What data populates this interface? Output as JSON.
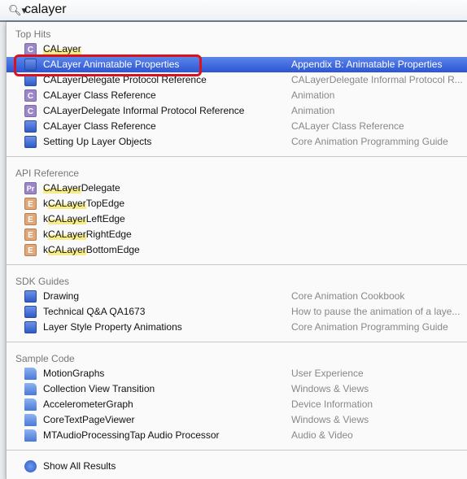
{
  "search": {
    "query": "calayer",
    "icon": "search-icon"
  },
  "sections": [
    {
      "title": "Top Hits",
      "items": [
        {
          "icon": "class",
          "glyph": "C",
          "pre": "",
          "hl": "CALayer",
          "post": "",
          "sub": ""
        },
        {
          "icon": "doc",
          "glyph": "",
          "pre": "CALayer Animatable Properties",
          "hl": "",
          "post": "",
          "sub": "Appendix B: Animatable Properties",
          "selected": true
        },
        {
          "icon": "doc",
          "glyph": "",
          "pre": "CALayerDelegate Protocol Reference",
          "hl": "",
          "post": "",
          "sub": "CALayerDelegate Informal Protocol R..."
        },
        {
          "icon": "class",
          "glyph": "C",
          "pre": "CALayer Class Reference",
          "hl": "",
          "post": "",
          "sub": "Animation"
        },
        {
          "icon": "class",
          "glyph": "C",
          "pre": "CALayerDelegate Informal Protocol Reference",
          "hl": "",
          "post": "",
          "sub": "Animation"
        },
        {
          "icon": "doc",
          "glyph": "",
          "pre": "CALayer Class Reference",
          "hl": "",
          "post": "",
          "sub": "CALayer Class Reference"
        },
        {
          "icon": "doc",
          "glyph": "",
          "pre": "Setting Up Layer Objects",
          "hl": "",
          "post": "",
          "sub": "Core Animation Programming Guide"
        }
      ]
    },
    {
      "title": "API Reference",
      "items": [
        {
          "icon": "proto",
          "glyph": "Pr",
          "pre": "",
          "hl": "CALayer",
          "post": "Delegate",
          "sub": ""
        },
        {
          "icon": "enum",
          "glyph": "E",
          "pre": "k",
          "hl": "CALayer",
          "post": "TopEdge",
          "sub": ""
        },
        {
          "icon": "enum",
          "glyph": "E",
          "pre": "k",
          "hl": "CALayer",
          "post": "LeftEdge",
          "sub": ""
        },
        {
          "icon": "enum",
          "glyph": "E",
          "pre": "k",
          "hl": "CALayer",
          "post": "RightEdge",
          "sub": ""
        },
        {
          "icon": "enum",
          "glyph": "E",
          "pre": "k",
          "hl": "CALayer",
          "post": "BottomEdge",
          "sub": ""
        }
      ]
    },
    {
      "title": "SDK Guides",
      "items": [
        {
          "icon": "doc",
          "glyph": "",
          "pre": "Drawing",
          "hl": "",
          "post": "",
          "sub": "Core Animation Cookbook"
        },
        {
          "icon": "doc",
          "glyph": "",
          "pre": "Technical Q&A QA1673",
          "hl": "",
          "post": "",
          "sub": "How to pause the animation of a laye..."
        },
        {
          "icon": "doc",
          "glyph": "",
          "pre": "Layer Style Property Animations",
          "hl": "",
          "post": "",
          "sub": "Core Animation Programming Guide"
        }
      ]
    },
    {
      "title": "Sample Code",
      "items": [
        {
          "icon": "sample",
          "glyph": "",
          "pre": "MotionGraphs",
          "hl": "",
          "post": "",
          "sub": "User Experience"
        },
        {
          "icon": "sample",
          "glyph": "",
          "pre": "Collection View Transition",
          "hl": "",
          "post": "",
          "sub": "Windows & Views"
        },
        {
          "icon": "sample",
          "glyph": "",
          "pre": "AccelerometerGraph",
          "hl": "",
          "post": "",
          "sub": "Device Information"
        },
        {
          "icon": "sample",
          "glyph": "",
          "pre": "CoreTextPageViewer",
          "hl": "",
          "post": "",
          "sub": "Windows & Views"
        },
        {
          "icon": "sample",
          "glyph": "",
          "pre": "MTAudioProcessingTap Audio Processor",
          "hl": "",
          "post": "",
          "sub": "Audio & Video"
        }
      ]
    }
  ],
  "show_all": "Show All Results",
  "colors": {
    "selection": "#2c55d6",
    "annotation": "#d9121d",
    "match_highlight": "#f6ec8a"
  }
}
